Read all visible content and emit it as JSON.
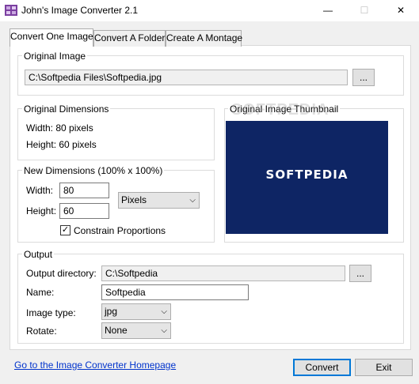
{
  "window": {
    "title": "John's Image Converter 2.1",
    "minimize": "—",
    "maximize": "☐",
    "close": "✕"
  },
  "tabs": [
    {
      "label": "Convert One Image",
      "active": true
    },
    {
      "label": "Convert A Folder",
      "active": false
    },
    {
      "label": "Create A Montage",
      "active": false
    }
  ],
  "original_image": {
    "group_title": "Original Image",
    "path": "C:\\Softpedia Files\\Softpedia.jpg",
    "browse_label": "..."
  },
  "original_dimensions": {
    "group_title": "Original Dimensions",
    "width_text": "Width: 80 pixels",
    "height_text": "Height: 60 pixels"
  },
  "thumbnail": {
    "group_title": "Original Image Thumbnail",
    "image_text": "SOFTPEDIA",
    "watermark": "SOFTPEDIA",
    "bg_color": "#0e2564"
  },
  "new_dimensions": {
    "group_title": "New Dimensions (100% x 100%)",
    "width_label": "Width:",
    "width_value": "80",
    "height_label": "Height:",
    "height_value": "60",
    "unit": "Pixels",
    "constrain_label": "Constrain Proportions",
    "constrain_checked": "✓"
  },
  "output": {
    "group_title": "Output",
    "dir_label": "Output directory:",
    "dir_value": "C:\\Softpedia",
    "browse_label": "...",
    "name_label": "Name:",
    "name_value": "Softpedia",
    "type_label": "Image type:",
    "type_value": "jpg",
    "rotate_label": "Rotate:",
    "rotate_value": "None"
  },
  "footer": {
    "homepage_link": "Go to the Image Converter Homepage",
    "convert_label": "Convert",
    "exit_label": "Exit"
  },
  "colors": {
    "accent": "#0078d7",
    "link": "#0033cc"
  }
}
